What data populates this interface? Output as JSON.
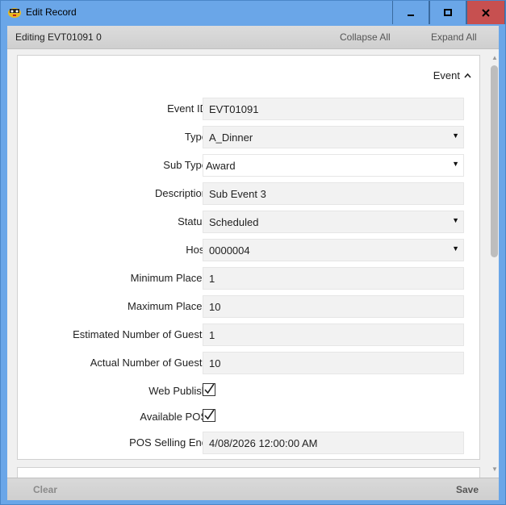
{
  "window": {
    "title": "Edit Record",
    "controls": {
      "minimize": "minimize-icon",
      "maximize": "maximize-icon",
      "close": "close-icon"
    }
  },
  "header": {
    "editing": "Editing EVT01091 0",
    "collapse_all": "Collapse All",
    "expand_all": "Expand All"
  },
  "section": {
    "title": "Event",
    "icon": "chevron-up-icon"
  },
  "fields": [
    {
      "label": "Event ID",
      "value": "EVT01091",
      "kind": "text"
    },
    {
      "label": "Type",
      "value": "A_Dinner",
      "kind": "select"
    },
    {
      "label": "Sub Type",
      "value": "Award",
      "kind": "select"
    },
    {
      "label": "Description",
      "value": "Sub Event 3",
      "kind": "text"
    },
    {
      "label": "Status",
      "value": "Scheduled",
      "kind": "select"
    },
    {
      "label": "Host",
      "value": "0000004",
      "kind": "select"
    },
    {
      "label": "Minimum Places",
      "value": "1",
      "kind": "text"
    },
    {
      "label": "Maximum Places",
      "value": "10",
      "kind": "text"
    },
    {
      "label": "Estimated Number of Guests",
      "value": "1",
      "kind": "text"
    },
    {
      "label": "Actual Number of Guests",
      "value": "10",
      "kind": "text"
    },
    {
      "label": "Web Publish",
      "checked": true,
      "kind": "checkbox"
    },
    {
      "label": "Available POS",
      "checked": true,
      "kind": "checkbox"
    },
    {
      "label": "POS Selling End",
      "value": "4/08/2026 12:00:00 AM",
      "kind": "text"
    }
  ],
  "footer": {
    "clear": "Clear",
    "save": "Save"
  },
  "colors": {
    "titlebar": "#6aa6e8",
    "close": "#c75050",
    "field_bg": "#f2f2f2"
  }
}
